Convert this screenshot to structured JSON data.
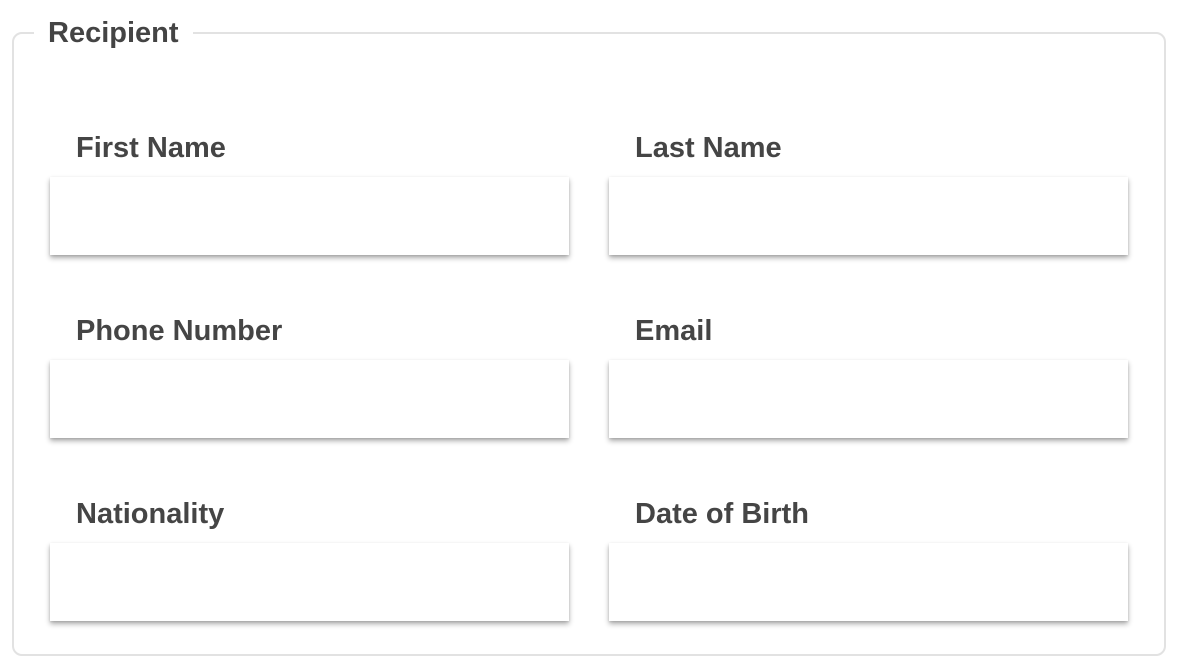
{
  "form": {
    "legend": "Recipient",
    "fields": {
      "first_name": {
        "label": "First Name",
        "value": "",
        "placeholder": ""
      },
      "last_name": {
        "label": "Last Name",
        "value": "",
        "placeholder": ""
      },
      "phone_number": {
        "label": "Phone Number",
        "value": "",
        "placeholder": ""
      },
      "email": {
        "label": "Email",
        "value": "",
        "placeholder": ""
      },
      "nationality": {
        "label": "Nationality",
        "value": "",
        "placeholder": ""
      },
      "date_of_birth": {
        "label": "Date of Birth",
        "value": "",
        "placeholder": ""
      }
    }
  },
  "colors": {
    "label_text": "#454545",
    "fieldset_border": "#e2e2e2",
    "background": "#ffffff"
  }
}
